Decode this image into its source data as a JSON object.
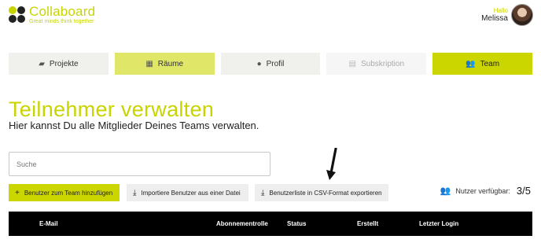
{
  "brand": {
    "name": "Collaboard",
    "tagline": "Great minds think together",
    "accent": "#c8d400"
  },
  "user": {
    "greeting": "Hallo",
    "name": "Melissa"
  },
  "tabs": [
    {
      "label": "Projekte",
      "icon": "folders-icon",
      "state": "normal"
    },
    {
      "label": "Räume",
      "icon": "grid-icon",
      "state": "light-active"
    },
    {
      "label": "Profil",
      "icon": "person-icon",
      "state": "normal"
    },
    {
      "label": "Subskription",
      "icon": "clipboard-icon",
      "state": "disabled"
    },
    {
      "label": "Team",
      "icon": "users-icon",
      "state": "active"
    }
  ],
  "page": {
    "title": "Teilnehmer verwalten",
    "subtitle": "Hier kannst Du alle Mitglieder Deines Teams verwalten."
  },
  "search": {
    "placeholder": "Suche"
  },
  "actions": {
    "add": "Benutzer zum Team hinzufügen",
    "import": "Importiere Benutzer aus einer Datei",
    "export": "Benutzerliste in CSV-Format exportieren"
  },
  "availability": {
    "label": "Nutzer verfügbar:",
    "count": "3/5"
  },
  "table": {
    "columns": [
      "E-Mail",
      "Abonnementrolle",
      "Status",
      "Erstellt",
      "Letzter Login"
    ]
  }
}
